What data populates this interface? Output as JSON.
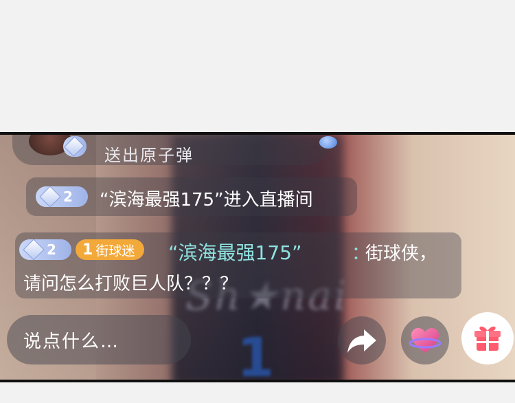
{
  "gift_message": {
    "text": "送出原子弹"
  },
  "enter_message": {
    "level": "2",
    "text": "“滨海最强175”进入直播间"
  },
  "chat_message": {
    "level": "2",
    "fan_badge_level": "1",
    "fan_badge_name": "街球迷",
    "username": "“滨海最强175”",
    "colon": "：",
    "line1": "街球侠，",
    "line2": "请问怎么打败巨人队？？？"
  },
  "bottom_bar": {
    "input_placeholder": "说点什么…",
    "icons": [
      "share-icon",
      "heart-like-icon",
      "gift-icon"
    ]
  },
  "background": {
    "jersey_number": "1"
  },
  "colors": {
    "username_accent": "#8fe3e0",
    "fan_badge": "#f3a83a",
    "gift_button": "#ff5a6e"
  }
}
